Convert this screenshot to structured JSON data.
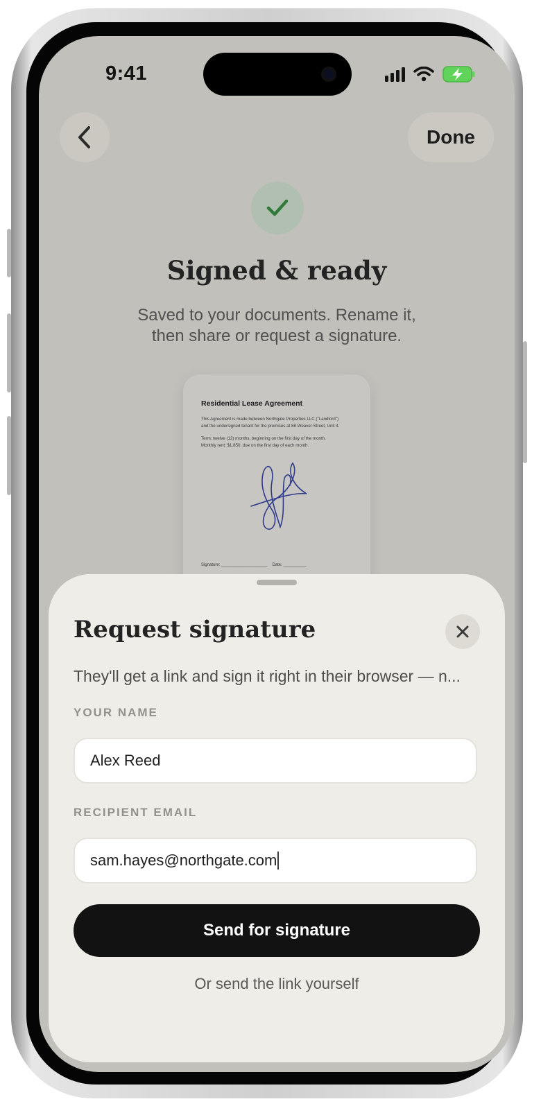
{
  "status_bar": {
    "time": "9:41",
    "icons": [
      "cellular-signal-icon",
      "wifi-icon",
      "battery-charging-icon"
    ],
    "battery_color": "#5fd35a"
  },
  "nav": {
    "back_icon": "chevron-left-icon",
    "done_label": "Done"
  },
  "hero": {
    "check_icon": "checkmark-icon",
    "accent": "#2f7a3a",
    "title": "Signed & ready",
    "subtitle_line1": "Saved to your documents. Rename it,",
    "subtitle_line2": "then share or request a signature."
  },
  "document": {
    "title": "Residential Lease Agreement",
    "para1_line1": "This Agreement is made between Northgate Properties LLC (\"Landlord\")",
    "para1_line2": "and the undersigned tenant for the premises at 88 Weaver Street, Unit 4.",
    "para2_line1": "Term: twelve (12) months, beginning on the first day of the month.",
    "para2_line2": "Monthly rent: $1,850, due on the first day of each month.",
    "signature_label": "Signature: ____________________",
    "date_label": "Date: __________",
    "signature_ink_color": "#2e3a8a"
  },
  "sheet": {
    "title": "Request signature",
    "close_icon": "close-icon",
    "description": "They'll get a link and sign it right in their browser — n...",
    "name_label": "YOUR NAME",
    "name_value": "Alex Reed",
    "email_label": "RECIPIENT EMAIL",
    "email_value": "sam.hayes@northgate.com",
    "send_label": "Send for signature",
    "alt_link": "Or send the link yourself"
  }
}
